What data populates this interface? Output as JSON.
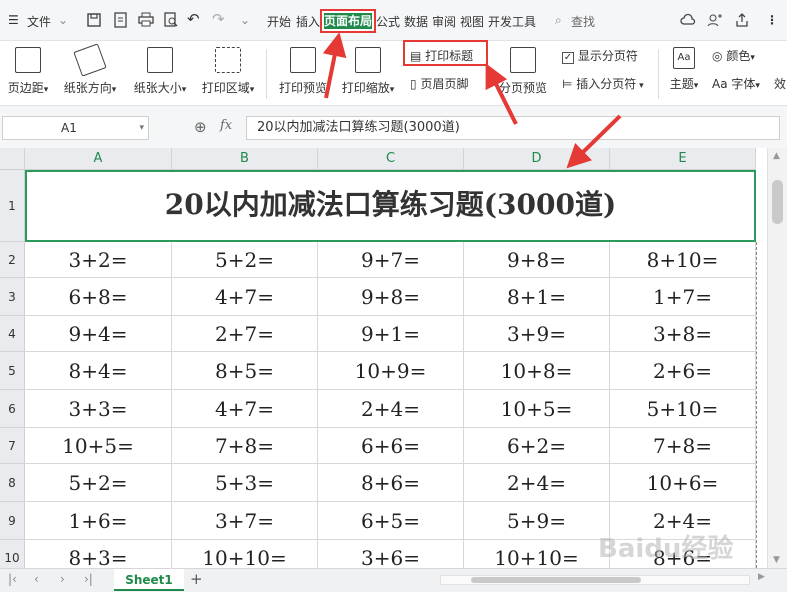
{
  "menubar": {
    "file_menu": "文件",
    "tabs": [
      "开始",
      "插入",
      "页面布局",
      "公式",
      "数据",
      "审阅",
      "视图",
      "开发工具"
    ],
    "search": "查找"
  },
  "ribbon": {
    "margins": "页边距",
    "orientation": "纸张方向",
    "paper_size": "纸张大小",
    "print_area": "打印区域",
    "print_preview": "打印预览",
    "print_scale": "打印缩放",
    "print_titles": "打印标题",
    "header_footer": "页眉页脚",
    "page_break_preview": "分页预览",
    "show_page_breaks": "显示分页符",
    "insert_page_break": "插入分页符",
    "theme": "主题",
    "color": "颜色",
    "font": "字体",
    "effects": "效"
  },
  "formula_bar": {
    "cell_ref": "A1",
    "fx": "fx",
    "value": "20以内加减法口算练习题(3000道)"
  },
  "grid": {
    "columns": [
      "A",
      "B",
      "C",
      "D",
      "E"
    ],
    "title": "20以内加减法口算练习题(3000道)",
    "rows": [
      {
        "num": "1"
      },
      {
        "num": "2",
        "cells": [
          "3+2=",
          "5+2=",
          "9+7=",
          "9+8=",
          "8+10="
        ]
      },
      {
        "num": "3",
        "cells": [
          "6+8=",
          "4+7=",
          "9+8=",
          "8+1=",
          "1+7="
        ]
      },
      {
        "num": "4",
        "cells": [
          "9+4=",
          "2+7=",
          "9+1=",
          "3+9=",
          "3+8="
        ]
      },
      {
        "num": "5",
        "cells": [
          "8+4=",
          "8+5=",
          "10+9=",
          "10+8=",
          "2+6="
        ]
      },
      {
        "num": "6",
        "cells": [
          "3+3=",
          "4+7=",
          "2+4=",
          "10+5=",
          "5+10="
        ]
      },
      {
        "num": "7",
        "cells": [
          "10+5=",
          "7+8=",
          "6+6=",
          "6+2=",
          "7+8="
        ]
      },
      {
        "num": "8",
        "cells": [
          "5+2=",
          "5+3=",
          "8+6=",
          "2+4=",
          "10+6="
        ]
      },
      {
        "num": "9",
        "cells": [
          "1+6=",
          "3+7=",
          "6+5=",
          "5+9=",
          "2+4="
        ]
      },
      {
        "num": "10",
        "cells": [
          "8+3=",
          "10+10=",
          "3+6=",
          "10+10=",
          "8+6="
        ]
      }
    ]
  },
  "bottom": {
    "sheet_tab": "Sheet1",
    "add_sheet": "+"
  },
  "watermark": "Baidu经验",
  "colors": {
    "accent_green": "#1f8a4c",
    "annotation_red": "#e53935"
  }
}
